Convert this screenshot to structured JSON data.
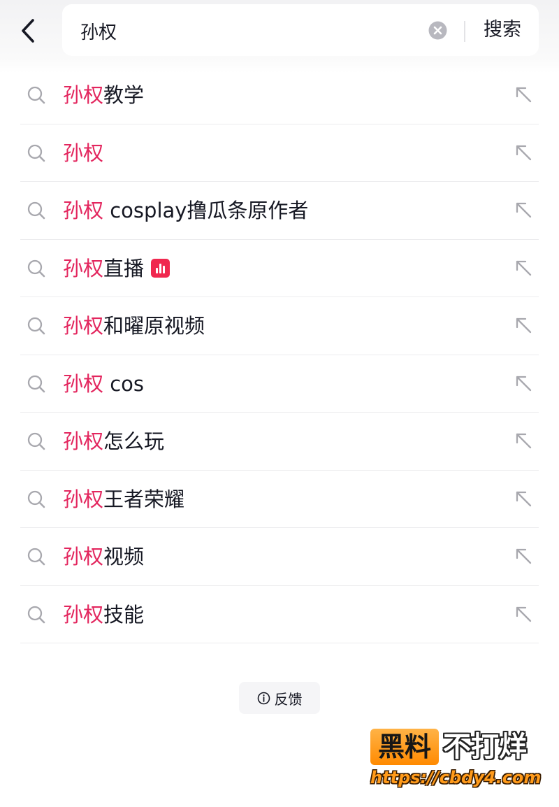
{
  "search": {
    "value": "孙权",
    "button_label": "搜索"
  },
  "suggestions": [
    {
      "highlight": "孙权",
      "rest": "教学",
      "badge": null
    },
    {
      "highlight": "孙权",
      "rest": "",
      "badge": null
    },
    {
      "highlight": "孙权",
      "rest": " cosplay撸瓜条原作者",
      "badge": null
    },
    {
      "highlight": "孙权",
      "rest": "直播",
      "badge": "live-icon"
    },
    {
      "highlight": "孙权",
      "rest": "和曜原视频",
      "badge": null
    },
    {
      "highlight": "孙权",
      "rest": " cos",
      "badge": null
    },
    {
      "highlight": "孙权",
      "rest": "怎么玩",
      "badge": null
    },
    {
      "highlight": "孙权",
      "rest": "王者荣耀",
      "badge": null
    },
    {
      "highlight": "孙权",
      "rest": "视频",
      "badge": null
    },
    {
      "highlight": "孙权",
      "rest": "技能",
      "badge": null
    }
  ],
  "feedback": {
    "label": "反馈"
  },
  "watermark": {
    "part1": "黑料",
    "part2": "不打烊",
    "url": "https://cbdy4.com"
  },
  "colors": {
    "highlight": "#e3265e",
    "live_badge": "#f0284f",
    "watermark_orange": "#ff9a1a"
  },
  "icons": {
    "back": "chevron-left-icon",
    "clear": "clear-x-icon",
    "row_search": "search-icon",
    "row_fill": "arrow-up-left-icon",
    "feedback": "info-circle-icon"
  }
}
